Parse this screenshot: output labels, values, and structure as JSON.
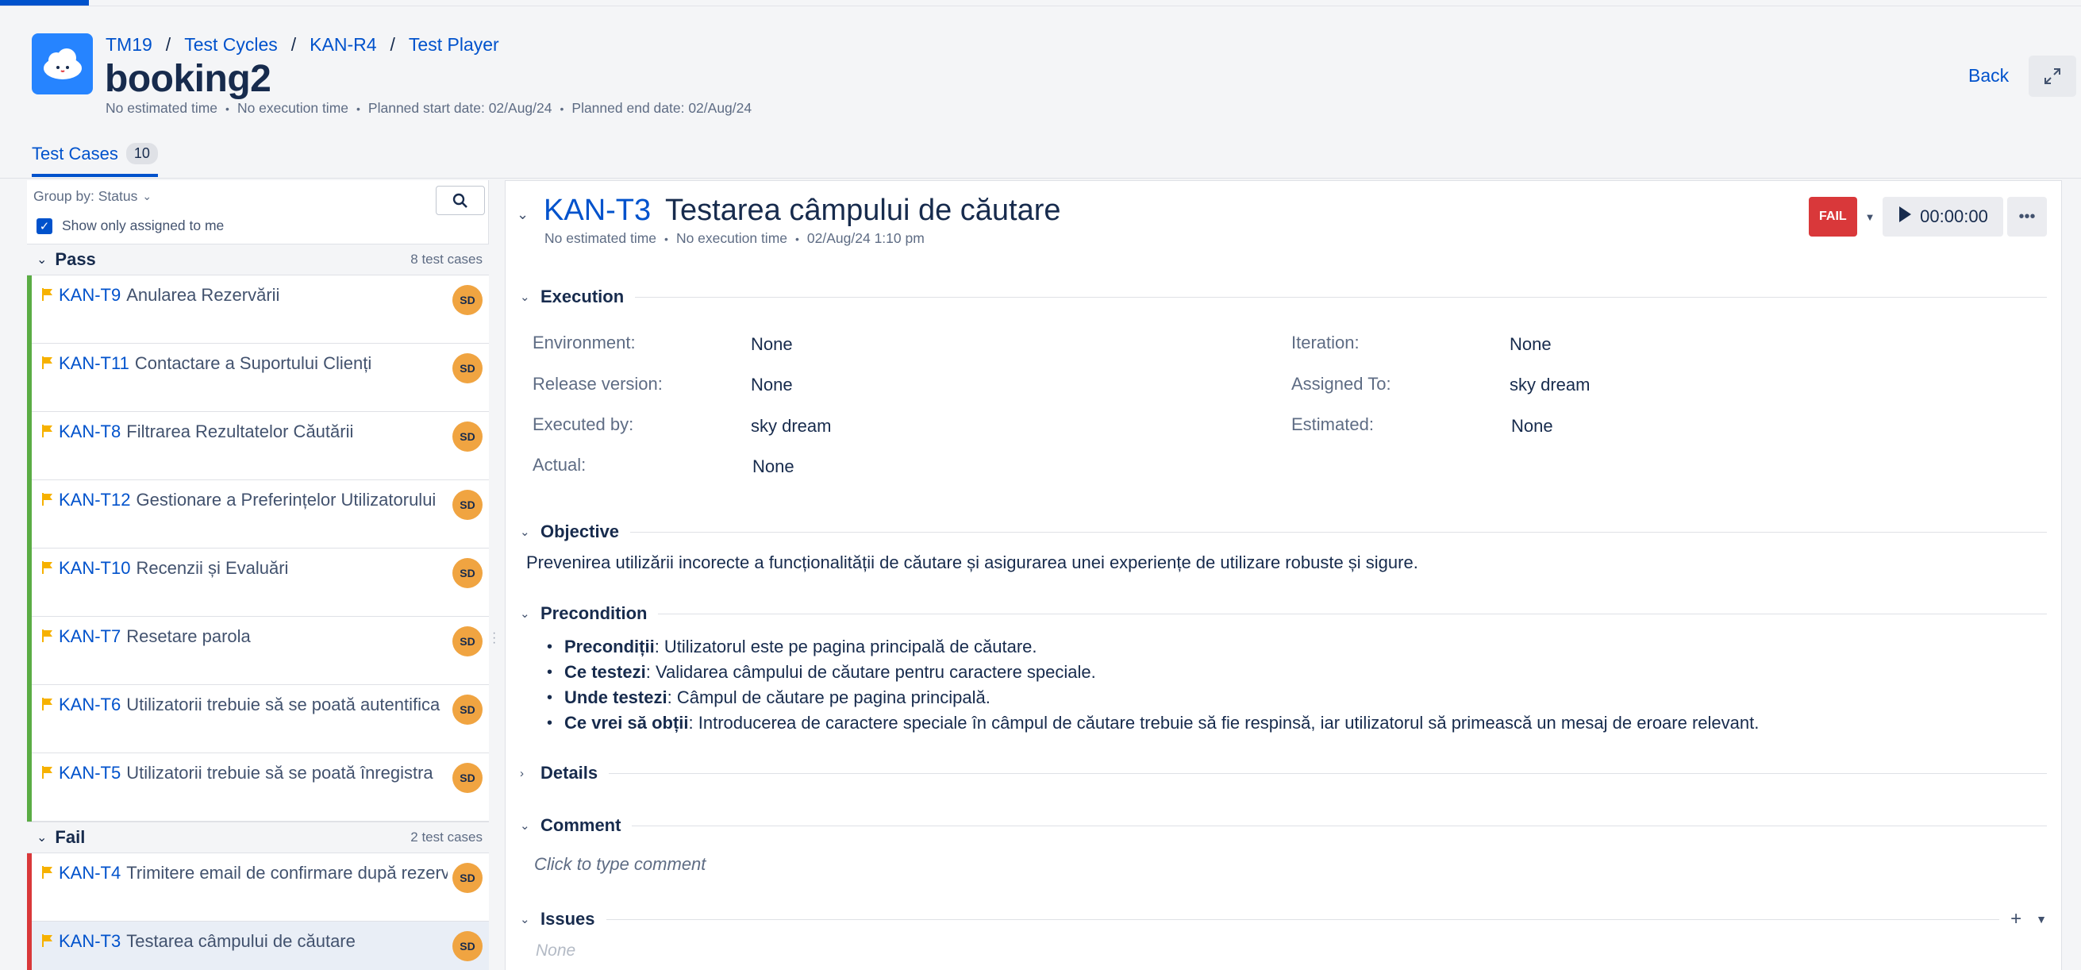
{
  "breadcrumb": [
    "TM19",
    "Test Cycles",
    "KAN-R4",
    "Test Player"
  ],
  "page": {
    "title": "booking2",
    "meta": [
      "No estimated time",
      "No execution time",
      "Planned start date: 02/Aug/24",
      "Planned end date: 02/Aug/24"
    ],
    "back_label": "Back"
  },
  "tabs": [
    {
      "label": "Test Cases",
      "count": "10"
    }
  ],
  "left": {
    "group_by_label": "Group by: Status",
    "show_only_assigned": "Show only assigned to me",
    "groups": [
      {
        "name": "Pass",
        "count_label": "8 test cases",
        "color": "#5aac44",
        "cases": [
          {
            "key": "KAN-T9",
            "name": "Anularea Rezervării",
            "avatar": "SD"
          },
          {
            "key": "KAN-T11",
            "name": "Contactare a Suportului Clienți",
            "avatar": "SD"
          },
          {
            "key": "KAN-T8",
            "name": "Filtrarea Rezultatelor Căutării",
            "avatar": "SD"
          },
          {
            "key": "KAN-T12",
            "name": "Gestionare a Preferințelor Utilizatorului",
            "avatar": "SD"
          },
          {
            "key": "KAN-T10",
            "name": "Recenzii și Evaluări",
            "avatar": "SD"
          },
          {
            "key": "KAN-T7",
            "name": "Resetare parola",
            "avatar": "SD"
          },
          {
            "key": "KAN-T6",
            "name": "Utilizatorii trebuie să se poată autentifica",
            "avatar": "SD"
          },
          {
            "key": "KAN-T5",
            "name": "Utilizatorii trebuie să se poată înregistra",
            "avatar": "SD"
          }
        ]
      },
      {
        "name": "Fail",
        "count_label": "2 test cases",
        "color": "#d9383a",
        "cases": [
          {
            "key": "KAN-T4",
            "name": "Trimitere email de confirmare după rezervare",
            "avatar": "SD"
          },
          {
            "key": "KAN-T3",
            "name": "Testarea câmpului de căutare",
            "avatar": "SD"
          }
        ]
      }
    ]
  },
  "detail": {
    "key": "KAN-T3",
    "name": "Testarea câmpului de căutare",
    "meta": [
      "No estimated time",
      "No execution time",
      "02/Aug/24 1:10 pm"
    ],
    "status": "FAIL",
    "status_color": "#d9383a",
    "timer": "00:00:00",
    "sections": {
      "execution": "Execution",
      "objective": "Objective",
      "precondition": "Precondition",
      "details": "Details",
      "comment": "Comment",
      "issues": "Issues"
    },
    "execution": {
      "environment_label": "Environment:",
      "environment": "None",
      "release_label": "Release version:",
      "release": "None",
      "executed_by_label": "Executed by:",
      "executed_by": "sky dream",
      "actual_label": "Actual:",
      "actual": "None",
      "iteration_label": "Iteration:",
      "iteration": "None",
      "assigned_to_label": "Assigned To:",
      "assigned_to": "sky dream",
      "estimated_label": "Estimated:",
      "estimated": "None"
    },
    "objective_text": "Prevenirea utilizării incorecte a funcționalității de căutare și asigurarea unei experiențe de utilizare robuste și sigure.",
    "precondition_items": [
      {
        "bold": "Precondiții",
        "text": ": Utilizatorul este pe pagina principală de căutare."
      },
      {
        "bold": "Ce testezi",
        "text": ": Validarea câmpului de căutare pentru caractere speciale."
      },
      {
        "bold": "Unde testezi",
        "text": ": Câmpul de căutare pe pagina principală."
      },
      {
        "bold": "Ce vrei să obții",
        "text": ": Introducerea de caractere speciale în câmpul de căutare trebuie să fie respinsă, iar utilizatorul să primească un mesaj de eroare relevant."
      }
    ],
    "comment_placeholder": "Click to type comment",
    "issues_value": "None"
  }
}
